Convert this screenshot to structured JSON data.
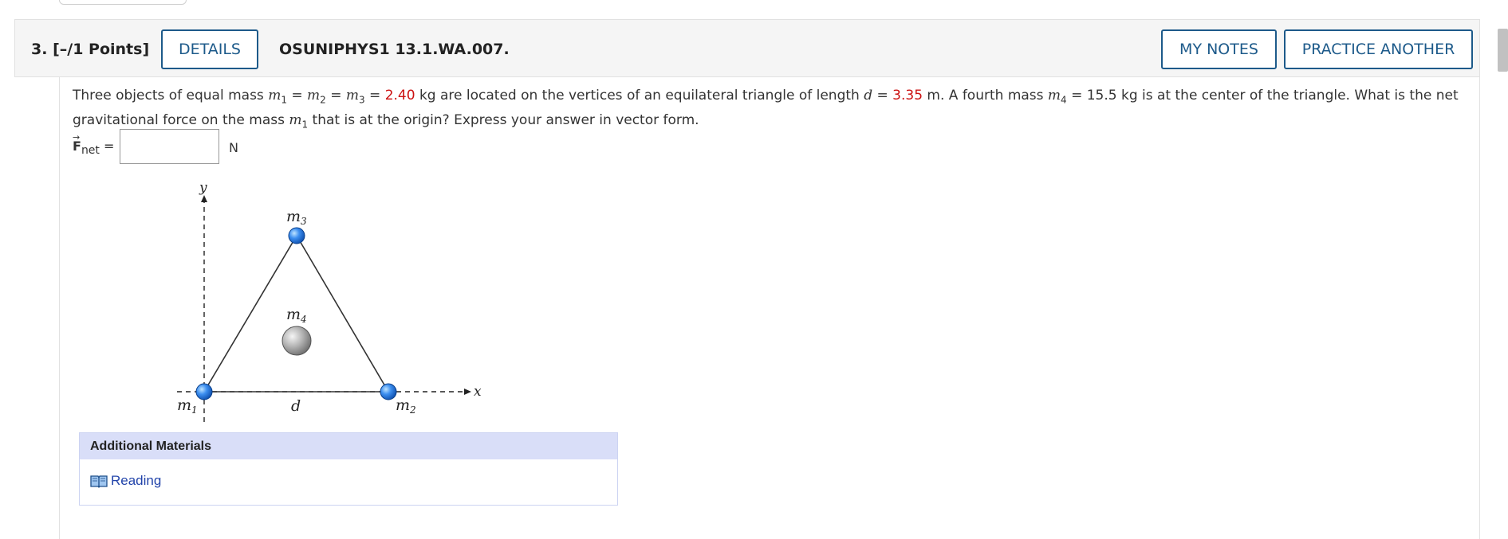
{
  "question": {
    "number": "3.",
    "points": "[–/1 Points]",
    "details_label": "DETAILS",
    "code": "OSUNIPHYS1 13.1.WA.007.",
    "my_notes_label": "MY NOTES",
    "practice_label": "PRACTICE ANOTHER",
    "text": {
      "p1": "Three objects of equal mass ",
      "m": "m",
      "s1": "1",
      "eq1": " = ",
      "s2": "2",
      "eq2": " = ",
      "s3": "3",
      "eq3": " = ",
      "mass_value": "2.40",
      "p2": " kg are located on the vertices of an equilateral triangle of length ",
      "d": "d",
      "eq4": " = ",
      "length_value": "3.35",
      "p3": " m. A fourth mass ",
      "s4": "4",
      "p4": " = 15.5 kg is at the center of the triangle. What is the net gravitational force on the mass ",
      "p5": " that is at the origin? Express your answer in vector form."
    },
    "answer": {
      "label_f": "F",
      "label_sub": "net",
      "label_eq": " =",
      "arrow": "→",
      "value": "",
      "unit": "N"
    }
  },
  "diagram": {
    "y_label": "y",
    "x_label": "x",
    "m1_label": "m",
    "m1_sub": "1",
    "m2_label": "m",
    "m2_sub": "2",
    "m3_label": "m",
    "m3_sub": "3",
    "m4_label": "m",
    "m4_sub": "4",
    "d_label": "d"
  },
  "materials": {
    "title": "Additional Materials",
    "reading_label": "Reading",
    "reading_icon": "book-icon"
  },
  "colors": {
    "accent": "#1d5a8a",
    "highlight": "#cc1111",
    "link": "#2244aa",
    "materials_header": "#d9def8"
  }
}
